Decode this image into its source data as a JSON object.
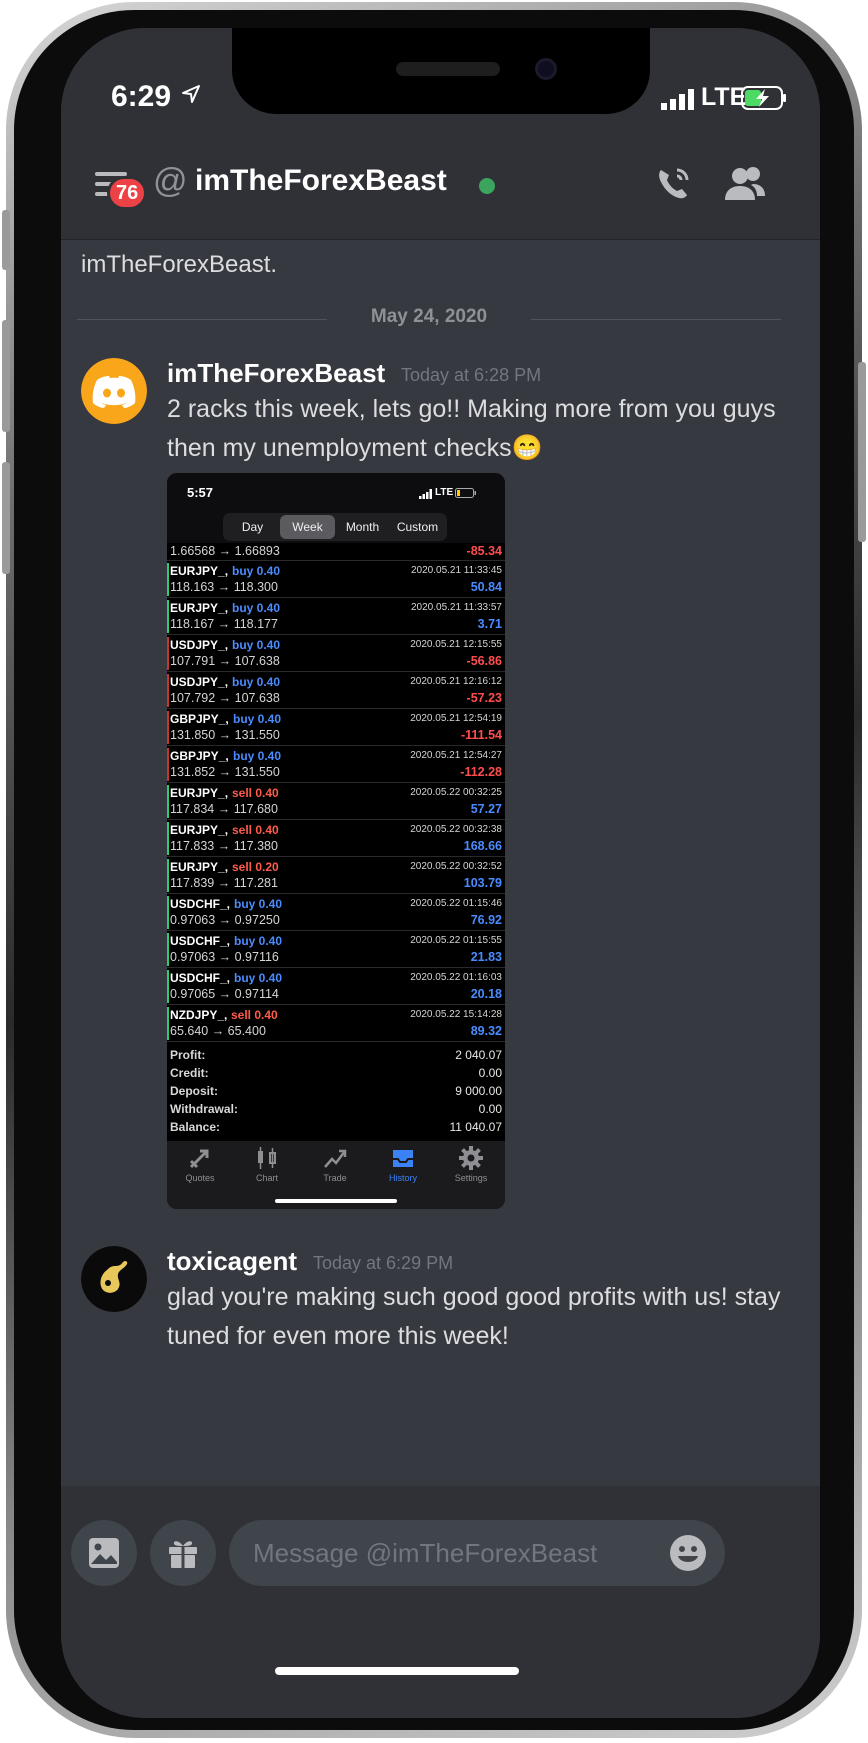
{
  "status_bar": {
    "time": "6:29",
    "network": "LTE"
  },
  "header": {
    "unread_badge": "76",
    "at_symbol": "@",
    "title": "imTheForexBeast"
  },
  "chat": {
    "intro_text": "This is the very beginning of your legendary conversation with imTheForexBeast.",
    "date_divider": "May 24, 2020",
    "messages": [
      {
        "author": "imTheForexBeast",
        "timestamp": "Today at 6:28 PM",
        "text": "2 racks this week, lets go!! Making more from you guys then my unemployment checks😁"
      },
      {
        "author": "toxicagent",
        "timestamp": "Today at 6:29 PM",
        "text": "glad you're making such good good profits with us! stay tuned for even more this week!"
      }
    ]
  },
  "attachment": {
    "status_time": "5:57",
    "status_network": "LTE",
    "segments": [
      "Day",
      "Week",
      "Month",
      "Custom"
    ],
    "active_segment": "Week",
    "first_row": {
      "prices": "1.66568 → 1.66893",
      "pl": "-85.34"
    },
    "trades": [
      {
        "symbol": "EURJPY_,",
        "side": "buy 0.40",
        "prices": "118.163 → 118.300",
        "datetime": "2020.05.21 11:33:45",
        "pl": "50.84"
      },
      {
        "symbol": "EURJPY_,",
        "side": "buy 0.40",
        "prices": "118.167 → 118.177",
        "datetime": "2020.05.21 11:33:57",
        "pl": "3.71"
      },
      {
        "symbol": "USDJPY_,",
        "side": "buy 0.40",
        "prices": "107.791 → 107.638",
        "datetime": "2020.05.21 12:15:55",
        "pl": "-56.86"
      },
      {
        "symbol": "USDJPY_,",
        "side": "buy 0.40",
        "prices": "107.792 → 107.638",
        "datetime": "2020.05.21 12:16:12",
        "pl": "-57.23"
      },
      {
        "symbol": "GBPJPY_,",
        "side": "buy 0.40",
        "prices": "131.850 → 131.550",
        "datetime": "2020.05.21 12:54:19",
        "pl": "-111.54"
      },
      {
        "symbol": "GBPJPY_,",
        "side": "buy 0.40",
        "prices": "131.852 → 131.550",
        "datetime": "2020.05.21 12:54:27",
        "pl": "-112.28"
      },
      {
        "symbol": "EURJPY_,",
        "side": "sell 0.40",
        "prices": "117.834 → 117.680",
        "datetime": "2020.05.22 00:32:25",
        "pl": "57.27"
      },
      {
        "symbol": "EURJPY_,",
        "side": "sell 0.40",
        "prices": "117.833 → 117.380",
        "datetime": "2020.05.22 00:32:38",
        "pl": "168.66"
      },
      {
        "symbol": "EURJPY_,",
        "side": "sell 0.20",
        "prices": "117.839 → 117.281",
        "datetime": "2020.05.22 00:32:52",
        "pl": "103.79"
      },
      {
        "symbol": "USDCHF_,",
        "side": "buy 0.40",
        "prices": "0.97063 → 0.97250",
        "datetime": "2020.05.22 01:15:46",
        "pl": "76.92"
      },
      {
        "symbol": "USDCHF_,",
        "side": "buy 0.40",
        "prices": "0.97063 → 0.97116",
        "datetime": "2020.05.22 01:15:55",
        "pl": "21.83"
      },
      {
        "symbol": "USDCHF_,",
        "side": "buy 0.40",
        "prices": "0.97065 → 0.97114",
        "datetime": "2020.05.22 01:16:03",
        "pl": "20.18"
      },
      {
        "symbol": "NZDJPY_,",
        "side": "sell 0.40",
        "prices": "65.640 → 65.400",
        "datetime": "2020.05.22 15:14:28",
        "pl": "89.32"
      }
    ],
    "summary": [
      {
        "label": "Profit:",
        "value": "2 040.07"
      },
      {
        "label": "Credit:",
        "value": "0.00"
      },
      {
        "label": "Deposit:",
        "value": "9 000.00"
      },
      {
        "label": "Withdrawal:",
        "value": "0.00"
      },
      {
        "label": "Balance:",
        "value": "11 040.07"
      }
    ],
    "tabs": [
      "Quotes",
      "Chart",
      "Trade",
      "History",
      "Settings"
    ],
    "active_tab": "History"
  },
  "composer": {
    "placeholder": "Message @imTheForexBeast"
  },
  "colors": {
    "background": "#36393f",
    "header": "#2f3136",
    "online": "#3ba55d",
    "badge": "#ed4245",
    "buy": "#4a8cff",
    "sell": "#ff5b4a",
    "profit": "#4a8cff",
    "loss": "#ff4d4d"
  }
}
